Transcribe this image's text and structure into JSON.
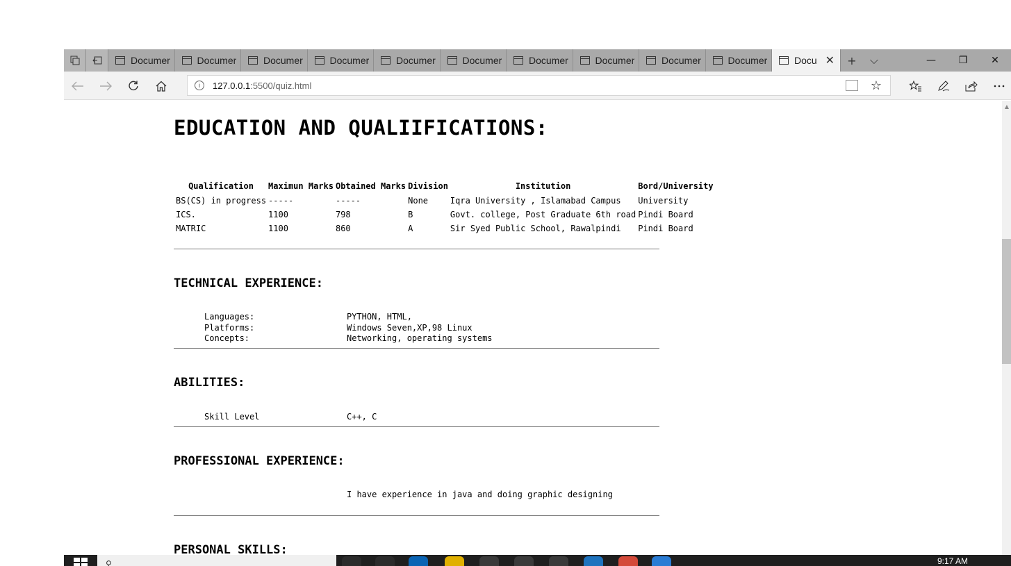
{
  "browser": {
    "tabs": [
      {
        "label": "Documer"
      },
      {
        "label": "Documer"
      },
      {
        "label": "Documer"
      },
      {
        "label": "Documer"
      },
      {
        "label": "Documer"
      },
      {
        "label": "Documer"
      },
      {
        "label": "Documer"
      },
      {
        "label": "Documer"
      },
      {
        "label": "Documer"
      },
      {
        "label": "Documer"
      }
    ],
    "active_tab": {
      "label": "Docu",
      "close_glyph": "✕"
    },
    "new_tab_glyph": "+",
    "tab_list_glyph": "⌵",
    "window_controls": {
      "minimize": "—",
      "restore": "❐",
      "close": "✕"
    },
    "url_host": "127.0.0.1",
    "url_path": ":5500/quiz.html",
    "url_info_glyph": "i",
    "icons": {
      "back": "back-arrow-icon",
      "forward": "forward-arrow-icon",
      "refresh": "refresh-icon",
      "home": "home-icon",
      "favorites": "favorites-icon",
      "notes": "pen-icon",
      "share": "share-icon",
      "more": "more-icon"
    }
  },
  "page": {
    "title": "EDUCATION AND QUALIIFICATIONS:",
    "education_table": {
      "headers": [
        "Qualification",
        "Maximun Marks",
        "Obtained Marks",
        "Division",
        "Institution",
        "Bord/University"
      ],
      "rows": [
        [
          "BS(CS) in progress",
          "-----",
          "-----",
          "None",
          "Iqra University , Islamabad Campus",
          "University"
        ],
        [
          "ICS.",
          "1100",
          "798",
          "B",
          "Govt. college, Post Graduate 6th road",
          "Pindi Board"
        ],
        [
          "MATRIC",
          "1100",
          "860",
          "A",
          "Sir Syed Public School, Rawalpindi",
          "Pindi Board"
        ]
      ]
    },
    "technical": {
      "heading": "TECHNICAL EXPERIENCE:",
      "items": [
        {
          "label": "Languages:",
          "value": "PYTHON, HTML,"
        },
        {
          "label": "Platforms:",
          "value": "Windows Seven,XP,98 Linux"
        },
        {
          "label": "Concepts:",
          "value": "Networking, operating systems"
        }
      ]
    },
    "abilities": {
      "heading": "ABILITIES:",
      "items": [
        {
          "label": "Skill Level",
          "value": "C++, C"
        }
      ]
    },
    "professional": {
      "heading": "PROFESSIONAL EXPERIENCE:",
      "text": "I have experience in java and doing graphic designing"
    },
    "personal": {
      "heading": "PERSONAL SKILLS:"
    }
  },
  "taskbar": {
    "clock": "9:17 AM"
  }
}
